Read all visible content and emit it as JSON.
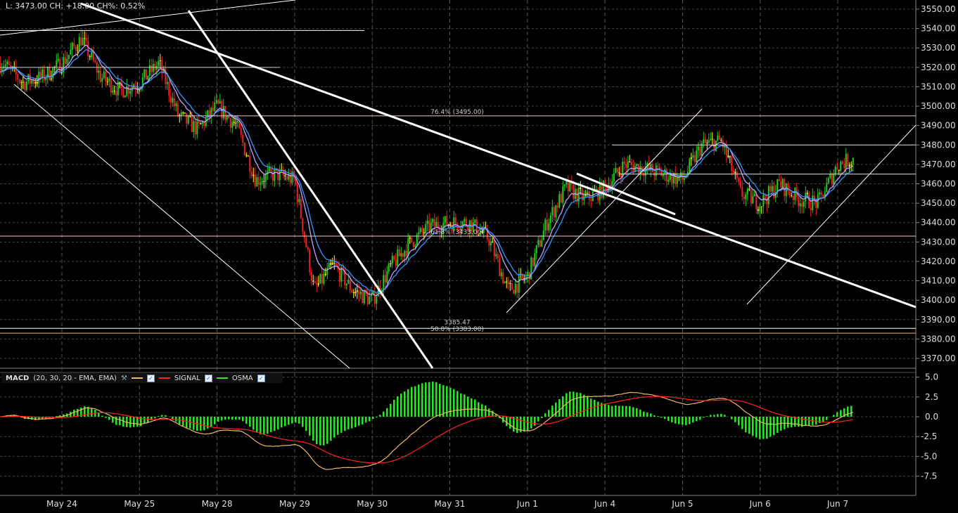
{
  "header": {
    "quote_text": "L: 3473.00 CH: +18.00 CH%: 0.52%"
  },
  "macd_legend": {
    "name": "MACD",
    "params": "(20, 30, 20 - EMA, EMA)",
    "macd_color": "#f0b860",
    "signal_label": "SIGNAL",
    "signal_color": "#ff2020",
    "osma_label": "OSMA",
    "osma_color": "#22ee22",
    "settings_icon": "wrench-icon",
    "checkbox_icon": "checkbox-checked-icon"
  },
  "chart_data": [
    {
      "type": "candlestick",
      "title": "",
      "x_tick_labels": [
        "May 24",
        "May 25",
        "May 28",
        "May 29",
        "May 30",
        "May 31",
        "Jun 1",
        "Jun 4",
        "Jun 5",
        "Jun 6",
        "Jun 7"
      ],
      "ylim": [
        3365,
        3555
      ],
      "y_ticks": [
        3370,
        3380,
        3390,
        3400,
        3410,
        3420,
        3430,
        3440,
        3450,
        3460,
        3470,
        3480,
        3490,
        3500,
        3510,
        3520,
        3530,
        3540,
        3550
      ],
      "grid": true,
      "colors": {
        "up": "#22cc22",
        "down": "#ee2222",
        "doji": "#ffff33",
        "ema_fast": "#c8a0ff",
        "ema_slow": "#3399ff"
      },
      "close_path": [
        {
          "t": "May 23 06:00",
          "close": 3522
        },
        {
          "t": "May 23 12:00",
          "close": 3512
        },
        {
          "t": "May 23 18:00",
          "close": 3515
        },
        {
          "t": "May 24 00:00",
          "close": 3522
        },
        {
          "t": "May 24 06:00",
          "close": 3535
        },
        {
          "t": "May 24 12:00",
          "close": 3515
        },
        {
          "t": "May 24 18:00",
          "close": 3508
        },
        {
          "t": "May 25 00:00",
          "close": 3512
        },
        {
          "t": "May 25 06:00",
          "close": 3522
        },
        {
          "t": "May 25 12:00",
          "close": 3495
        },
        {
          "t": "May 25 18:00",
          "close": 3488
        },
        {
          "t": "May 28 00:00",
          "close": 3500
        },
        {
          "t": "May 28 06:00",
          "close": 3490
        },
        {
          "t": "May 28 12:00",
          "close": 3462
        },
        {
          "t": "May 28 18:00",
          "close": 3465
        },
        {
          "t": "May 29 00:00",
          "close": 3462
        },
        {
          "t": "May 29 06:00",
          "close": 3405
        },
        {
          "t": "May 29 12:00",
          "close": 3418
        },
        {
          "t": "May 29 18:00",
          "close": 3405
        },
        {
          "t": "May 30 00:00",
          "close": 3400
        },
        {
          "t": "May 30 06:00",
          "close": 3418
        },
        {
          "t": "May 30 12:00",
          "close": 3430
        },
        {
          "t": "May 30 18:00",
          "close": 3438
        },
        {
          "t": "May 31 00:00",
          "close": 3440
        },
        {
          "t": "May 31 06:00",
          "close": 3440
        },
        {
          "t": "May 31 12:00",
          "close": 3432
        },
        {
          "t": "May 31 18:00",
          "close": 3405
        },
        {
          "t": "Jun 1 00:00",
          "close": 3412
        },
        {
          "t": "Jun 1 06:00",
          "close": 3440
        },
        {
          "t": "Jun 1 12:00",
          "close": 3458
        },
        {
          "t": "Jun 1 18:00",
          "close": 3452
        },
        {
          "t": "Jun 4 00:00",
          "close": 3458
        },
        {
          "t": "Jun 4 06:00",
          "close": 3470
        },
        {
          "t": "Jun 4 12:00",
          "close": 3468
        },
        {
          "t": "Jun 4 18:00",
          "close": 3465
        },
        {
          "t": "Jun 5 00:00",
          "close": 3462
        },
        {
          "t": "Jun 5 06:00",
          "close": 3480
        },
        {
          "t": "Jun 5 12:00",
          "close": 3482
        },
        {
          "t": "Jun 5 18:00",
          "close": 3455
        },
        {
          "t": "Jun 6 00:00",
          "close": 3450
        },
        {
          "t": "Jun 6 06:00",
          "close": 3460
        },
        {
          "t": "Jun 6 12:00",
          "close": 3452
        },
        {
          "t": "Jun 6 18:00",
          "close": 3450
        },
        {
          "t": "Jun 7 00:00",
          "close": 3470
        },
        {
          "t": "Jun 7 05:00",
          "close": 3473
        }
      ],
      "horizontal_levels": [
        {
          "price": 3539,
          "color": "#ffffff"
        },
        {
          "price": 3520,
          "color": "#cccccc"
        },
        {
          "price": 3480,
          "color": "#dddddd"
        },
        {
          "price": 3465,
          "color": "#dddddd"
        },
        {
          "price": 3495,
          "color": "#f0c8c0",
          "label": "76.4% (3495.00)"
        },
        {
          "price": 3433,
          "color": "#f0c8c0",
          "label": "61.8% (3433.00)"
        },
        {
          "price": 3385.47,
          "color": "#ffffff",
          "label": "3385.47"
        },
        {
          "price": 3383,
          "color": "#e8b860",
          "label": "50.0% (3383.00)"
        }
      ]
    },
    {
      "type": "macd",
      "ylim": [
        -10,
        6
      ],
      "y_ticks": [
        5.0,
        2.5,
        0.0,
        -2.5,
        -5.0,
        -7.5
      ],
      "y_tick_labels": [
        "5.0",
        "2.5",
        "0.0",
        "-2.5",
        "-5.0",
        "-7.5"
      ],
      "grid": true
    }
  ]
}
